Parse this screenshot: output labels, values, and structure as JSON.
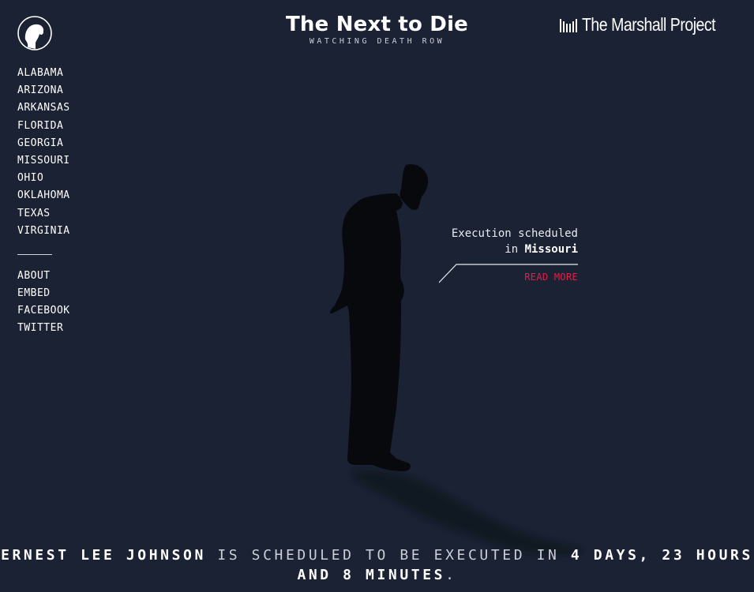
{
  "header": {
    "title": "The Next to Die",
    "subtitle": "WATCHING DEATH ROW",
    "logo_icon": "bowed-head-icon",
    "brand": "The Marshall Project",
    "brand_icon": "marshall-bars-icon"
  },
  "nav": {
    "states": [
      "ALABAMA",
      "ARIZONA",
      "ARKANSAS",
      "FLORIDA",
      "GEORGIA",
      "MISSOURI",
      "OHIO",
      "OKLAHOMA",
      "TEXAS",
      "VIRGINIA"
    ],
    "links": [
      "ABOUT",
      "EMBED",
      "FACEBOOK",
      "TWITTER"
    ]
  },
  "callout": {
    "line1": "Execution scheduled",
    "prefix": "in",
    "state": "Missouri",
    "read_more": "READ MORE"
  },
  "countdown": {
    "name": "ERNEST LEE JOHNSON",
    "middle": "IS SCHEDULED TO BE EXECUTED IN",
    "time": "4 DAYS, 23 HOURS AND 8 MINUTES",
    "end": "."
  },
  "colors": {
    "background": "#1b2233",
    "accent": "#e0204a",
    "text": "#ffffff"
  }
}
